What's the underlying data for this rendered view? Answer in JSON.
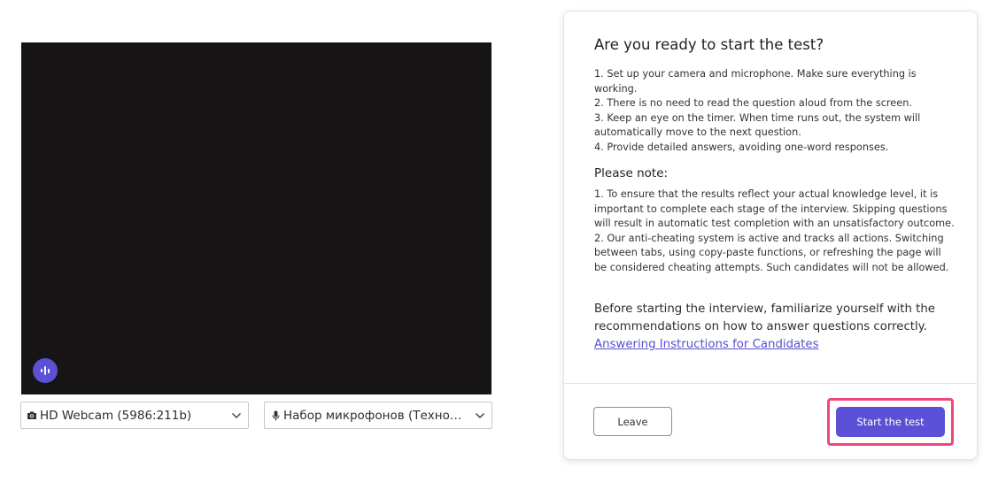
{
  "preview": {
    "audio_indicator_icon": "voice-waveform-icon",
    "colors": {
      "video_bg": "#171415",
      "accent": "#5b50d6"
    }
  },
  "devices": {
    "camera": {
      "icon": "camera-icon",
      "label": "HD Webcam (5986:211b)"
    },
    "microphone": {
      "icon": "microphone-icon",
      "label": "Набор микрофонов (Технология Intel® Smart Sound)"
    }
  },
  "card": {
    "title": "Are you ready to start the test?",
    "steps": [
      "1. Set up your camera and microphone. Make sure everything is working.",
      "2. There is no need to read the question aloud from the screen.",
      "3. Keep an eye on the timer. When time runs out, the system will automatically move to the next question.",
      "4. Provide detailed answers, avoiding one-word responses."
    ],
    "note_heading": "Please note:",
    "notes": [
      "1. To ensure that the results reflect your actual knowledge level, it is important to complete each stage of the interview. Skipping questions will result in automatic test completion with an unsatisfactory outcome.",
      "2. Our anti-cheating system is active and tracks all actions. Switching between tabs, using copy-paste functions, or refreshing the page will be considered cheating attempts. Such candidates will not be allowed."
    ],
    "recommendation_text": "Before starting the interview, familiarize yourself with the recommendations on how to answer questions correctly.",
    "recommendation_link": "Answering Instructions for Candidates",
    "leave_label": "Leave",
    "start_label": "Start the test",
    "colors": {
      "highlight": "#f0457f",
      "link": "#5a4fd0"
    }
  }
}
